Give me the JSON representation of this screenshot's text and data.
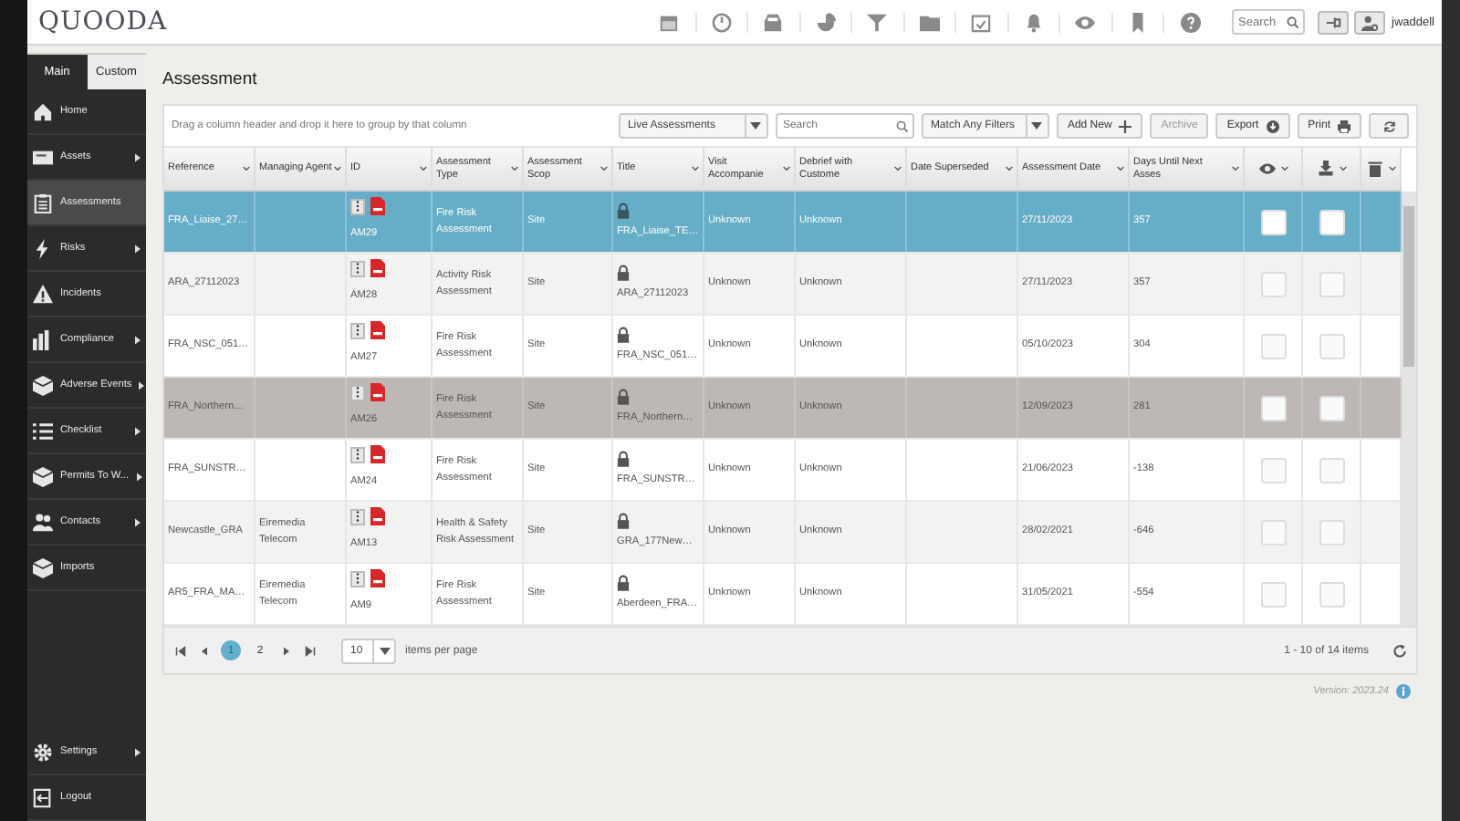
{
  "app": {
    "logo": "QUOODA",
    "search": {
      "placeholder": "Search"
    },
    "username": "jwaddell"
  },
  "nav_tabs": [
    {
      "label": "Main",
      "selected": true
    },
    {
      "label": "Custom",
      "selected": false
    }
  ],
  "sidebar": {
    "items": [
      {
        "label": "Home",
        "has_submenu": false,
        "selected": false
      },
      {
        "label": "Assets",
        "has_submenu": true,
        "selected": false
      },
      {
        "label": "Assessments",
        "has_submenu": false,
        "selected": true
      },
      {
        "label": "Risks",
        "has_submenu": true,
        "selected": false
      },
      {
        "label": "Incidents",
        "has_submenu": false,
        "selected": false
      },
      {
        "label": "Compliance",
        "has_submenu": true,
        "selected": false
      },
      {
        "label": "Adverse Events",
        "has_submenu": true,
        "selected": false
      },
      {
        "label": "Checklist",
        "has_submenu": true,
        "selected": false
      },
      {
        "label": "Permits To W...",
        "has_submenu": true,
        "selected": false
      },
      {
        "label": "Contacts",
        "has_submenu": true,
        "selected": false
      },
      {
        "label": "Imports",
        "has_submenu": false,
        "selected": false
      }
    ],
    "footer_items": [
      {
        "label": "Settings",
        "has_submenu": true
      },
      {
        "label": "Logout",
        "has_submenu": false
      }
    ]
  },
  "page_title": "Assessment",
  "toolbar": {
    "group_hint": "Drag a column header and drop it here to group by that column",
    "view_dropdown": "Live Assessments",
    "search": {
      "placeholder": "Search"
    },
    "filter_dropdown": "Match Any Filters",
    "buttons": [
      {
        "label": "Add New",
        "disabled": false
      },
      {
        "label": "Archive",
        "disabled": true
      },
      {
        "label": "Export",
        "disabled": false
      },
      {
        "label": "Print",
        "disabled": false
      }
    ]
  },
  "table": {
    "columns": [
      "Reference",
      "Managing Agent",
      "ID",
      "Assessment Type",
      "Assessment Scop",
      "Title",
      "Visit Accompanie",
      "Debrief with Custome",
      "Date Superseded",
      "Assessment Date",
      "Days Until Next Asses"
    ],
    "rows": [
      {
        "reference": "FRA_Liaise_27…",
        "managing_agent": "",
        "id": "AM29",
        "type": "Fire Risk Assessment",
        "scope": "Site",
        "title": "FRA_Liaise_TE…",
        "visit_accompanied": "Unknown",
        "debrief": "Unknown",
        "date_superseded": "",
        "assessment_date": "27/11/2023",
        "days_until_next": "357",
        "view_checked": false,
        "download_checked": false,
        "selected": true,
        "hovered": false
      },
      {
        "reference": "ARA_27112023",
        "managing_agent": "",
        "id": "AM28",
        "type": "Activity Risk Assessment",
        "scope": "Site",
        "title": "ARA_27112023",
        "visit_accompanied": "Unknown",
        "debrief": "Unknown",
        "date_superseded": "",
        "assessment_date": "27/11/2023",
        "days_until_next": "357",
        "view_checked": false,
        "download_checked": false,
        "selected": false,
        "hovered": false
      },
      {
        "reference": "FRA_NSC_051…",
        "managing_agent": "",
        "id": "AM27",
        "type": "Fire Risk Assessment",
        "scope": "Site",
        "title": "FRA_NSC_051…",
        "visit_accompanied": "Unknown",
        "debrief": "Unknown",
        "date_superseded": "",
        "assessment_date": "05/10/2023",
        "days_until_next": "304",
        "view_checked": false,
        "download_checked": false,
        "selected": false,
        "hovered": false
      },
      {
        "reference": "FRA_Northern…",
        "managing_agent": "",
        "id": "AM26",
        "type": "Fire Risk Assessment",
        "scope": "Site",
        "title": "FRA_Northern…",
        "visit_accompanied": "Unknown",
        "debrief": "Unknown",
        "date_superseded": "",
        "assessment_date": "12/09/2023",
        "days_until_next": "281",
        "view_checked": false,
        "download_checked": false,
        "selected": false,
        "hovered": true
      },
      {
        "reference": "FRA_SUNSTR…",
        "managing_agent": "",
        "id": "AM24",
        "type": "Fire Risk Assessment",
        "scope": "Site",
        "title": "FRA_SUNSTR…",
        "visit_accompanied": "Unknown",
        "debrief": "Unknown",
        "date_superseded": "",
        "assessment_date": "21/06/2023",
        "days_until_next": "-138",
        "view_checked": false,
        "download_checked": false,
        "selected": false,
        "hovered": false
      },
      {
        "reference": "Newcastle_GRA",
        "managing_agent": "Eiremedia Telecom",
        "id": "AM13",
        "type": "Health & Safety Risk Assessment",
        "scope": "Site",
        "title": "GRA_177New…",
        "visit_accompanied": "Unknown",
        "debrief": "Unknown",
        "date_superseded": "",
        "assessment_date": "28/02/2021",
        "days_until_next": "-646",
        "view_checked": false,
        "download_checked": false,
        "selected": false,
        "hovered": false
      },
      {
        "reference": "AR5_FRA_MA…",
        "managing_agent": "Eiremedia Telecom",
        "id": "AM9",
        "type": "Fire Risk Assessment",
        "scope": "Site",
        "title": "Aberdeen_FRA…",
        "visit_accompanied": "Unknown",
        "debrief": "Unknown",
        "date_superseded": "",
        "assessment_date": "31/05/2021",
        "days_until_next": "-554",
        "view_checked": false,
        "download_checked": false,
        "selected": false,
        "hovered": false
      }
    ]
  },
  "pager": {
    "pages": [
      {
        "label": "1",
        "selected": true
      },
      {
        "label": "2",
        "selected": false
      }
    ],
    "page_size": "10",
    "page_size_label": "items per page",
    "summary": "1 - 10 of 14 items"
  },
  "version": "Version: 2023.24"
}
